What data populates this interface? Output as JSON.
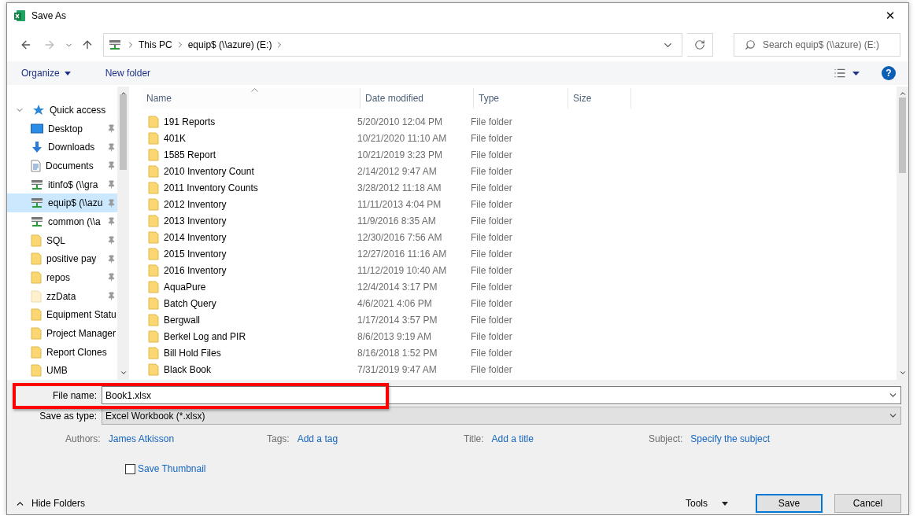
{
  "window": {
    "title": "Save As",
    "close": "✕"
  },
  "address_bar": {
    "crumbs": [
      "This PC",
      "equip$ (\\\\azure) (E:)"
    ]
  },
  "search": {
    "placeholder": "Search equip$ (\\\\azure) (E:)"
  },
  "toolbar": {
    "organize": "Organize",
    "new_folder": "New folder",
    "help": "?"
  },
  "navigation": [
    {
      "label": "Quick access",
      "kind": "quick",
      "expanded": true,
      "children": [
        {
          "label": "Desktop",
          "kind": "desktop",
          "pinned": true,
          "selected": false
        },
        {
          "label": "Downloads",
          "kind": "downloads",
          "pinned": true,
          "selected": false
        },
        {
          "label": "Documents",
          "kind": "documents",
          "pinned": true,
          "selected": false
        },
        {
          "label": "itinfo$ (\\\\gra",
          "kind": "drive",
          "pinned": true,
          "selected": false
        },
        {
          "label": "equip$ (\\\\azu",
          "kind": "drive",
          "pinned": true,
          "selected": true
        },
        {
          "label": "common (\\\\a",
          "kind": "drive",
          "pinned": true,
          "selected": false
        },
        {
          "label": "SQL",
          "kind": "folder",
          "pinned": true,
          "selected": false
        },
        {
          "label": "positive pay",
          "kind": "folder",
          "pinned": true,
          "selected": false
        },
        {
          "label": "repos",
          "kind": "folder",
          "pinned": true,
          "selected": false
        },
        {
          "label": "zzData",
          "kind": "faded-folder",
          "pinned": true,
          "selected": false
        },
        {
          "label": "Equipment Statu",
          "kind": "folder",
          "pinned": false,
          "selected": false
        },
        {
          "label": "Project Manager",
          "kind": "folder",
          "pinned": false,
          "selected": false
        },
        {
          "label": "Report Clones",
          "kind": "folder",
          "pinned": false,
          "selected": false
        },
        {
          "label": "UMB",
          "kind": "folder",
          "pinned": false,
          "selected": false
        }
      ]
    }
  ],
  "columns": [
    {
      "label": "Name",
      "sorted": true
    },
    {
      "label": "Date modified",
      "sorted": false
    },
    {
      "label": "Type",
      "sorted": false
    },
    {
      "label": "Size",
      "sorted": false
    }
  ],
  "rows": [
    {
      "name": "191 Reports",
      "date": "5/20/2010 12:04 PM",
      "type": "File folder"
    },
    {
      "name": "401K",
      "date": "10/21/2020 11:10 AM",
      "type": "File folder"
    },
    {
      "name": "1585 Report",
      "date": "10/21/2019 3:23 PM",
      "type": "File folder"
    },
    {
      "name": "2010 Inventory Count",
      "date": "2/14/2012 9:47 AM",
      "type": "File folder"
    },
    {
      "name": "2011 Inventory Counts",
      "date": "3/28/2012 11:18 AM",
      "type": "File folder"
    },
    {
      "name": "2012 Inventory",
      "date": "11/11/2013 4:04 PM",
      "type": "File folder"
    },
    {
      "name": "2013 Inventory",
      "date": "11/9/2016 8:35 AM",
      "type": "File folder"
    },
    {
      "name": "2014 Inventory",
      "date": "12/30/2016 7:56 AM",
      "type": "File folder"
    },
    {
      "name": "2015 Inventory",
      "date": "12/27/2016 11:16 AM",
      "type": "File folder"
    },
    {
      "name": "2016 Inventory",
      "date": "11/12/2019 10:40 AM",
      "type": "File folder"
    },
    {
      "name": "AquaPure",
      "date": "12/4/2014 3:17 PM",
      "type": "File folder"
    },
    {
      "name": "Batch Query",
      "date": "4/6/2021 4:06 PM",
      "type": "File folder"
    },
    {
      "name": "Bergwall",
      "date": "1/17/2014 3:57 PM",
      "type": "File folder"
    },
    {
      "name": "Berkel Log and PIR",
      "date": "8/6/2013 9:19 AM",
      "type": "File folder"
    },
    {
      "name": "Bill Hold Files",
      "date": "8/16/2018 1:52 PM",
      "type": "File folder"
    },
    {
      "name": "Black Book",
      "date": "7/31/2019 9:47 AM",
      "type": "File folder"
    }
  ],
  "form": {
    "file_name_label": "File name:",
    "file_name": "Book1.xlsx",
    "highlighted": true,
    "type_label": "Save as type:",
    "type_value": "Excel Workbook (*.xlsx)"
  },
  "metadata": [
    {
      "label": "Authors:",
      "value": "James Atkisson"
    },
    {
      "label": "Tags:",
      "value": "Add a tag"
    },
    {
      "label": "Title:",
      "value": "Add a title"
    },
    {
      "label": "Subject:",
      "value": "Specify the subject"
    }
  ],
  "save_thumbnail": {
    "label": "Save Thumbnail",
    "checked": false
  },
  "hide_folders": "Hide Folders",
  "buttons": [
    {
      "label": "Tools",
      "kind": "menu"
    },
    {
      "label": "Save",
      "kind": "push",
      "default": true
    },
    {
      "label": "Cancel",
      "kind": "push",
      "default": false
    }
  ]
}
